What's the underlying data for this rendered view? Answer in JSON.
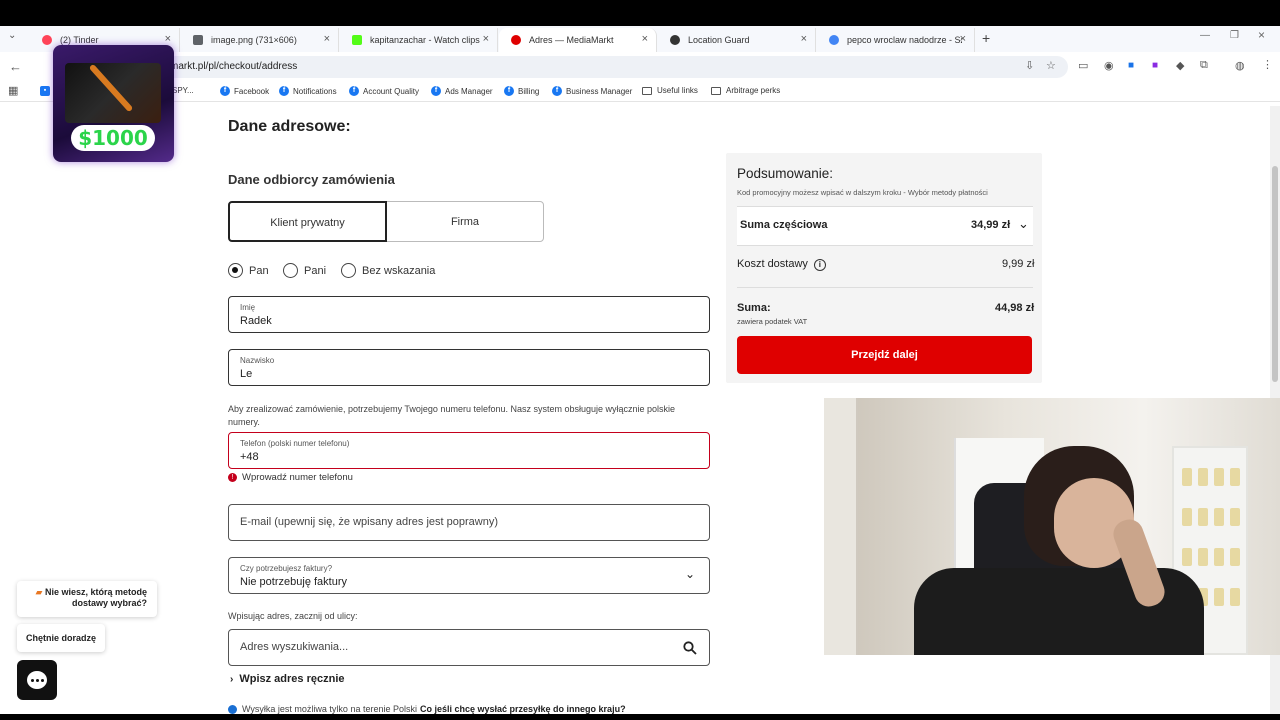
{
  "browser": {
    "tabs": [
      {
        "label": "(2) Tinder",
        "color": "#ff4458"
      },
      {
        "label": "image.png (731×606)",
        "color": "#5f6368"
      },
      {
        "label": "kapitanzachar - Watch clips on",
        "color": "#53fc18"
      },
      {
        "label": "Adres — MediaMarkt",
        "color": "#df0000"
      },
      {
        "label": "Location Guard",
        "color": "#333333"
      },
      {
        "label": "pepco wroclaw nadodrze - Szuk",
        "color": "#4285f4"
      }
    ],
    "url": "markt.pl/pl/checkout/address",
    "bookmarks": [
      "SPY...",
      "Facebook",
      "Notifications",
      "Account Quality",
      "Ads Manager",
      "Billing",
      "Business Manager",
      "Useful links",
      "Arbitrage perks"
    ]
  },
  "promo": {
    "price": "$1000"
  },
  "form": {
    "title": "Dane adresowe:",
    "recipient_title": "Dane odbiorcy zamówienia",
    "segment_private": "Klient prywatny",
    "segment_company": "Firma",
    "salutations": [
      "Pan",
      "Pani",
      "Bez wskazania"
    ],
    "first_name_label": "Imię",
    "first_name_value": "Radek",
    "last_name_label": "Nazwisko",
    "last_name_value": "Le",
    "phone_note": "Aby zrealizować zamówienie, potrzebujemy Twojego numeru telefonu. Nasz system obsługuje wyłącznie polskie numery.",
    "phone_label": "Telefon (polski numer telefonu)",
    "phone_value": "+48",
    "phone_error": "Wprowadź numer telefonu",
    "email_placeholder": "E-mail (upewnij się, że wpisany adres jest poprawny)",
    "invoice_label": "Czy potrzebujesz faktury?",
    "invoice_value": "Nie potrzebuję faktury",
    "address_hint": "Wpisując adres, zacznij od ulicy:",
    "address_placeholder": "Adres wyszukiwania...",
    "manual_link": "Wpisz adres ręcznie",
    "shipping_note": "Wysyłka jest możliwa tylko na terenie Polski",
    "shipping_link": "Co jeśli chcę wysłać przesyłkę do innego kraju?"
  },
  "summary": {
    "title": "Podsumowanie:",
    "note": "Kod promocyjny możesz wpisać w dalszym kroku - Wybór metody płatności",
    "subtotal_label": "Suma częściowa",
    "subtotal_value": "34,99 zł",
    "shipping_label": "Koszt dostawy",
    "shipping_value": "9,99 zł",
    "total_label": "Suma:",
    "total_value": "44,98 zł",
    "vat_note": "zawiera podatek VAT",
    "cta": "Przejdź dalej"
  },
  "help": {
    "question": "Nie wiesz, którą metodę dostawy wybrać?",
    "button": "Chętnie doradzę"
  },
  "colors": {
    "brand_red": "#df0000",
    "error_red": "#c4001c"
  }
}
